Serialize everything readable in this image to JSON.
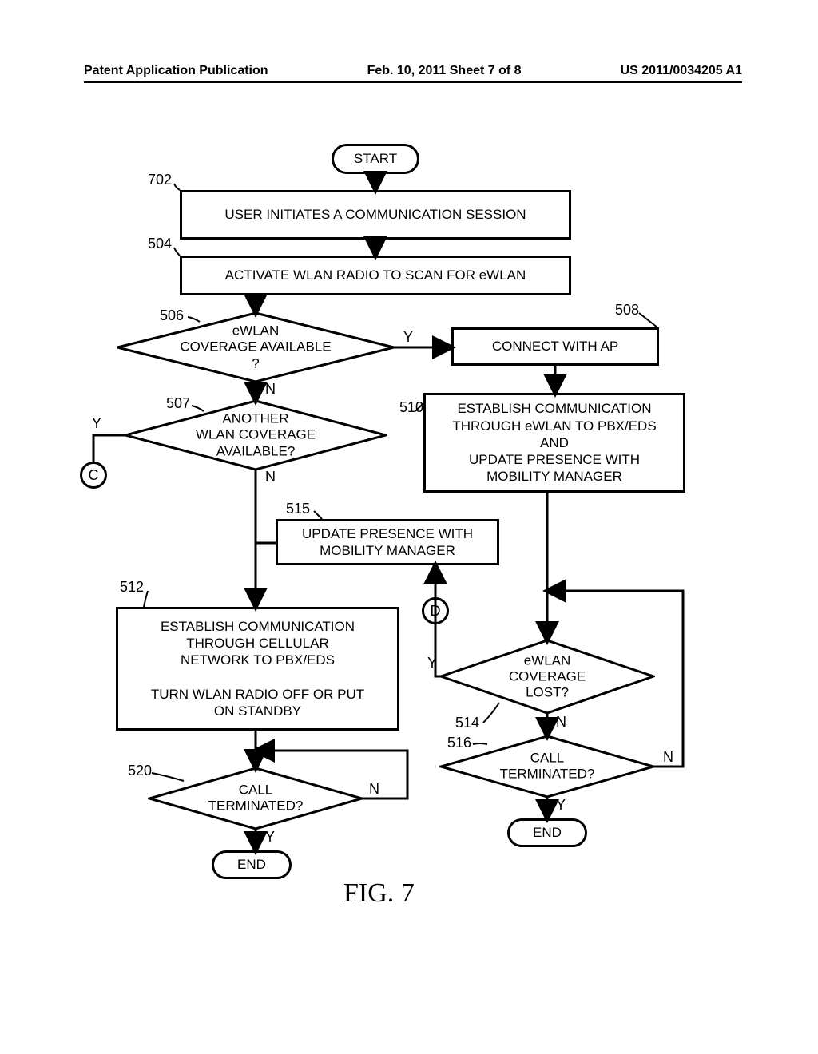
{
  "header": {
    "left": "Patent Application Publication",
    "center": "Feb. 10, 2011  Sheet 7 of 8",
    "right": "US 2011/0034205 A1"
  },
  "figure_label": "FIG. 7",
  "nodes": {
    "start": "START",
    "n702": "USER INITIATES A COMMUNICATION SESSION",
    "n504": "ACTIVATE WLAN RADIO TO SCAN FOR eWLAN",
    "n506": "eWLAN\nCOVERAGE AVAILABLE\n?",
    "n507": "ANOTHER\nWLAN COVERAGE\nAVAILABLE?",
    "n508": "CONNECT WITH AP",
    "n510": "ESTABLISH COMMUNICATION\nTHROUGH eWLAN TO PBX/EDS\nAND\nUPDATE PRESENCE WITH\nMOBILITY MANAGER",
    "n515": "UPDATE PRESENCE WITH\nMOBILITY MANAGER",
    "n512": "ESTABLISH COMMUNICATION\nTHROUGH CELLULAR\nNETWORK TO PBX/EDS\n\nTURN WLAN RADIO OFF OR PUT\nON STANDBY",
    "n514": "eWLAN\nCOVERAGE\nLOST?",
    "n516": "CALL\nTERMINATED?",
    "n520": "CALL\nTERMINATED?",
    "end1": "END",
    "end2": "END",
    "connC": "C",
    "connD": "D"
  },
  "refs": {
    "r702": "702",
    "r504": "504",
    "r506": "506",
    "r507": "507",
    "r508": "508",
    "r510": "510",
    "r512": "512",
    "r514": "514",
    "r515": "515",
    "r516": "516",
    "r520": "520"
  },
  "branches": {
    "Y": "Y",
    "N": "N"
  }
}
